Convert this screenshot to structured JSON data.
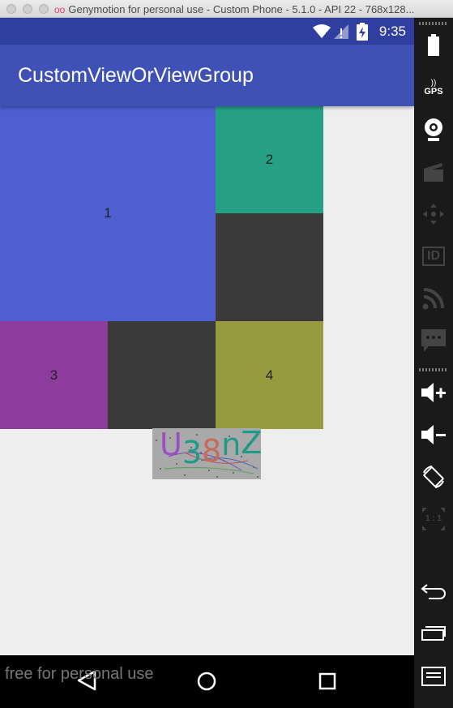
{
  "window": {
    "title": "Genymotion for personal use - Custom Phone - 5.1.0 - API 22 - 768x128..."
  },
  "statusbar": {
    "time": "9:35"
  },
  "appbar": {
    "title": "CustomViewOrViewGroup"
  },
  "boxes": [
    {
      "label": "1",
      "color": "#4f5fd0"
    },
    {
      "label": "2",
      "color": "#26a084"
    },
    {
      "label": "",
      "color": "#3b3a3b"
    },
    {
      "label": "3",
      "color": "#8e3b9e"
    },
    {
      "label": "",
      "color": "#3b3a3b"
    },
    {
      "label": "4",
      "color": "#979a3f"
    }
  ],
  "captcha": {
    "text": "U38nZ"
  },
  "watermark": "free for personal use",
  "navbar": {
    "buttons": [
      "back-icon",
      "home-icon",
      "recents-icon"
    ]
  },
  "sidebar": {
    "gps_label": "GPS",
    "id_label": "ID",
    "ratio_label": "1 : 1"
  },
  "colors": {
    "statusbar": "#303f9f",
    "appbar": "#3f51b5",
    "background": "#eeeeee"
  }
}
